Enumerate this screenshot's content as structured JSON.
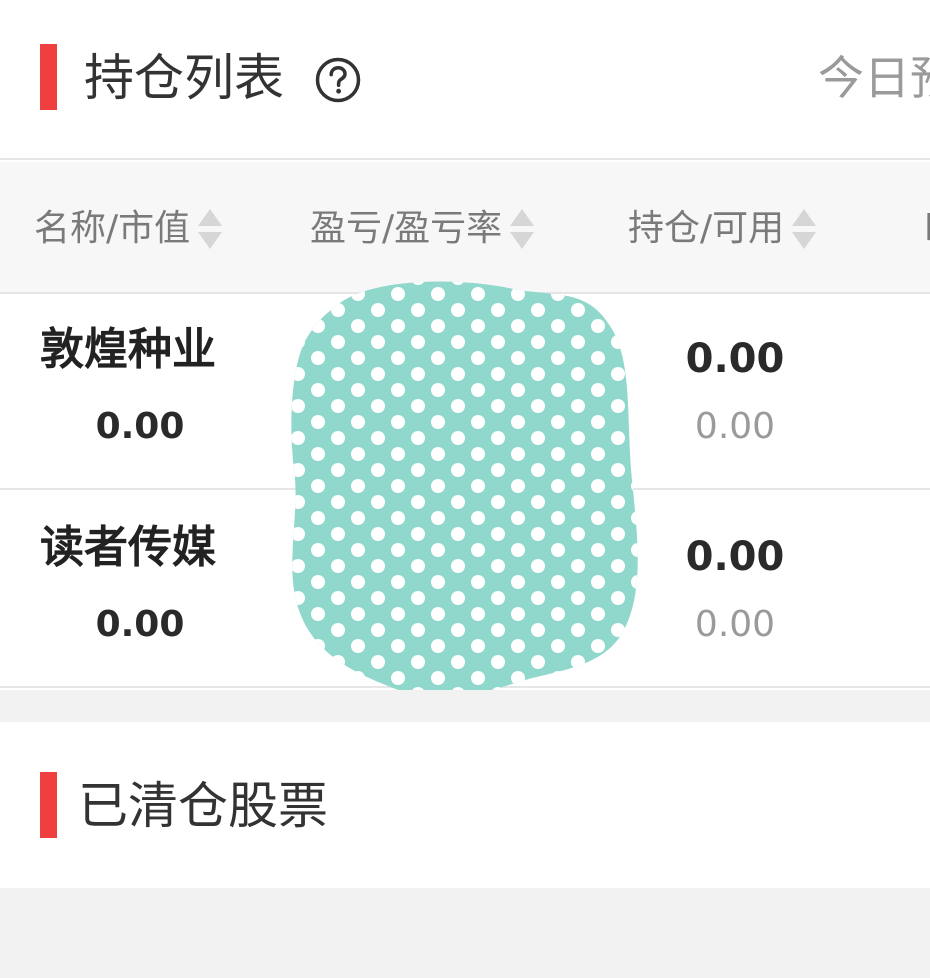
{
  "holdings": {
    "title": "持仓列表",
    "help_icon": "question-circle-icon",
    "today_link": "今日预",
    "columns": [
      {
        "label": "名称/市值",
        "sort_icon": "sort-updown-icon"
      },
      {
        "label": "盈亏/盈亏率",
        "sort_icon": "sort-updown-icon"
      },
      {
        "label": "持仓/可用",
        "sort_icon": "sort-updown-icon"
      }
    ],
    "extra_column_fragment": "l",
    "rows": [
      {
        "name": "敦煌种业",
        "market_value": "0.00",
        "position": "0.00",
        "available": "0.00"
      },
      {
        "name": "读者传媒",
        "market_value": "0.00",
        "position": "0.00",
        "available": "0.00"
      }
    ]
  },
  "cleared": {
    "title": "已清仓股票"
  },
  "colors": {
    "accent": "#ef3f3f",
    "redaction_fill": "#91d8cc",
    "redaction_dots": "#ffffff",
    "divider": "#e6e6e6",
    "background": "#f2f2f2"
  }
}
